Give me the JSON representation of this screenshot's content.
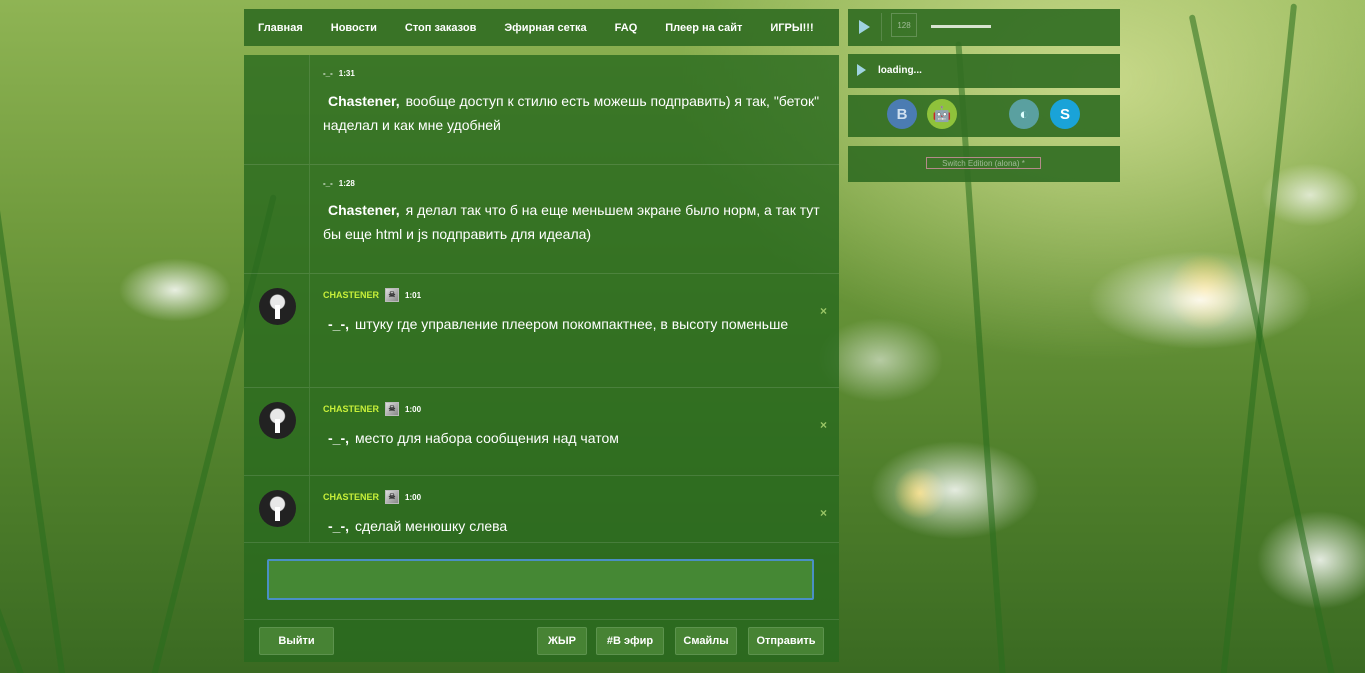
{
  "nav": {
    "items": [
      "Главная",
      "Новости",
      "Стоп заказов",
      "Эфирная сетка",
      "FAQ",
      "Плеер на сайт",
      "ИГРЫ!!!"
    ]
  },
  "messages": [
    {
      "author": "-_-",
      "time": "1:31",
      "addressee": "Chastener,",
      "text": "вообще доступ к стилю есть можешь подправить) я так, \"беток\" наделал и как мне удобней",
      "has_avatar": false
    },
    {
      "author": "-_-",
      "time": "1:28",
      "addressee": "Chastener,",
      "text": "я делал так что б на еще меньшем экране было норм, а так тут бы еще html и js подправить для идеала)",
      "has_avatar": false
    },
    {
      "author": "CHASTENER",
      "time": "1:01",
      "addressee": "-_-,",
      "text": "штуку где управление плеером покомпактнее, в высоту поменьше",
      "has_avatar": true
    },
    {
      "author": "CHASTENER",
      "time": "1:00",
      "addressee": "-_-,",
      "text": "место для набора сообщения над чатом",
      "has_avatar": true
    },
    {
      "author": "CHASTENER",
      "time": "1:00",
      "addressee": "-_-,",
      "text": "сделай менюшку слева",
      "has_avatar": true
    }
  ],
  "delete_symbol": "×",
  "composer": {
    "value": "",
    "placeholder": ""
  },
  "buttons": {
    "logout": "Выйти",
    "bold": "ЖЫР",
    "on_air": "#В эфир",
    "smiles": "Смайлы",
    "send": "Отправить"
  },
  "player": {
    "volume": "128",
    "status": "loading...",
    "progress_fraction": 0.0
  },
  "social": [
    {
      "icon": "vk-icon",
      "glyph": "B",
      "color": "#4b7cb2"
    },
    {
      "icon": "android-icon",
      "glyph": "A",
      "color": "#8fc23b"
    },
    {
      "icon": "apple-icon",
      "glyph": "",
      "color": "#7a9a6a"
    },
    {
      "icon": "tunein-icon",
      "glyph": "T",
      "color": "#5aa0a0"
    },
    {
      "icon": "skype-icon",
      "glyph": "S",
      "color": "#1aa3d8"
    }
  ],
  "switch_edition": "Switch Edition (alona) *",
  "colors": {
    "nick": "#c8f03a",
    "panel": "#32692a",
    "input_border": "#4a8fc4"
  }
}
